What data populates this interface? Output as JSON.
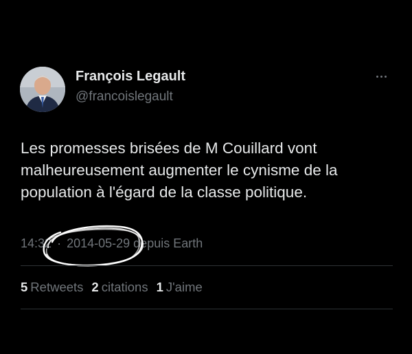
{
  "author": {
    "name": "François Legault",
    "handle": "@francoislegault",
    "avatar_icon": "profile-photo"
  },
  "menu": {
    "more_icon": "more-dots-icon"
  },
  "tweet": {
    "lines": [
      "Les promesses brisées de M Couillard vont",
      "malheureusement augmenter le cynisme de la",
      "population à l'égard de la classe politique."
    ]
  },
  "meta": {
    "time": "14:32",
    "separator": "·",
    "date": "2014-05-29",
    "source": "depuis Earth"
  },
  "stats": {
    "retweets_count": "5",
    "retweets_label": "Retweets",
    "quotes_count": "2",
    "quotes_label": "citations",
    "likes_count": "1",
    "likes_label": "J'aime"
  },
  "colors": {
    "background": "#000000",
    "primary_text": "#e7e9ea",
    "secondary_text": "#71767b",
    "divider": "#2f3336",
    "annotation": "#ffffff"
  }
}
